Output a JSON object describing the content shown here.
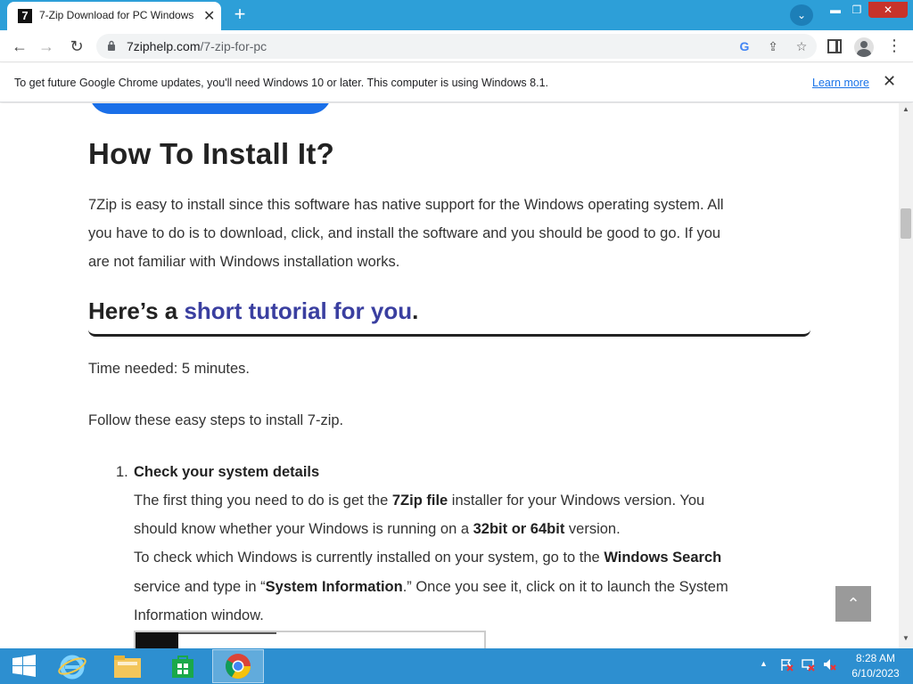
{
  "browser": {
    "tab_title": "7-Zip Download for PC Windows",
    "tab_favicon": "7",
    "tab_close": "✕",
    "new_tab": "+",
    "url_host": "7ziphelp.com",
    "url_path": "/7-zip-for-pc",
    "icons": {
      "back": "←",
      "forward": "→",
      "reload": "↻",
      "google": "G",
      "share": "⇪",
      "star": "☆",
      "menu": "⋮",
      "tab_search": "⌄",
      "minimize": "▬",
      "maximize": "❐",
      "close": "✕"
    }
  },
  "infobar": {
    "message": "To get future Google Chrome updates, you'll need Windows 10 or later. This computer is using Windows 8.1.",
    "learn_more": "Learn more",
    "close": "✕"
  },
  "article": {
    "heading": "How To Install It?",
    "intro_line1": "7Zip is easy to install since this software has native support for the Windows operating system. All",
    "intro_line2": "you have to do is to download, click, and install the software and you should be good to go. If you",
    "intro_line3": "are not familiar with Windows installation works.",
    "subheading_prefix": "Here’s a ",
    "subheading_accent": "short tutorial for you",
    "subheading_suffix": ".",
    "time_needed": "Time needed: 5 minutes.",
    "follow": "Follow these easy steps to install 7-zip.",
    "step1": {
      "number": "1.",
      "title": "Check your system details",
      "l1_a": "The first thing you need to do is get the ",
      "l1_b": "7Zip file",
      "l1_c": " installer for your Windows version. You",
      "l2_a": "should know whether your Windows is running on a ",
      "l2_b": "32bit or 64bit",
      "l2_c": " version.",
      "l3_a": "To check which Windows is currently installed on your system, go to the ",
      "l3_b": "Windows Search",
      "l4_a": "service and type in “",
      "l4_b": "System Information",
      "l4_c": ".” Once you see it, click on it to launch the System",
      "l5": "Information window."
    },
    "scroll_top": "⌃"
  },
  "taskbar": {
    "time": "8:28 AM",
    "date": "6/10/2023",
    "tray_arrow": "▲"
  },
  "colors": {
    "titlebar": "#2d9fd8",
    "taskbar": "#2d8fd0",
    "accent_heading": "#3a3fa0",
    "link": "#1a73e8"
  }
}
